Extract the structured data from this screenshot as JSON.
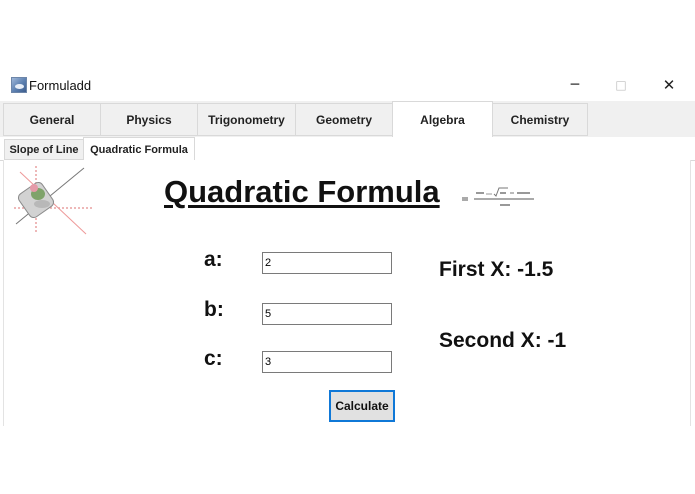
{
  "window": {
    "title": "Formuladd",
    "controls": {
      "minimize": "─",
      "maximize": "□",
      "close": "✕"
    }
  },
  "tabs": [
    {
      "label": "General",
      "active": false
    },
    {
      "label": "Physics",
      "active": false
    },
    {
      "label": "Trigonometry",
      "active": false
    },
    {
      "label": "Geometry",
      "active": false
    },
    {
      "label": "Algebra",
      "active": true
    },
    {
      "label": "Chemistry",
      "active": false
    }
  ],
  "subtabs": [
    {
      "label": "Slope of Line",
      "active": false
    },
    {
      "label": "Quadratic Formula",
      "active": true
    }
  ],
  "main": {
    "heading": "Quadratic Formula",
    "formula_image": {
      "icon": "quadratic-formula-image"
    },
    "logo": {
      "icon": "graph-logo-icon"
    },
    "inputs": [
      {
        "label": "a:",
        "value": "2"
      },
      {
        "label": "b:",
        "value": "5"
      },
      {
        "label": "c:",
        "value": "3"
      }
    ],
    "results": {
      "first": "First X:  -1.5",
      "second": "Second X: -1"
    },
    "calculate_label": "Calculate"
  },
  "colors": {
    "accent": "#0f78d7",
    "tab_bg": "#f0f0f0",
    "border": "#d9d9d9"
  }
}
